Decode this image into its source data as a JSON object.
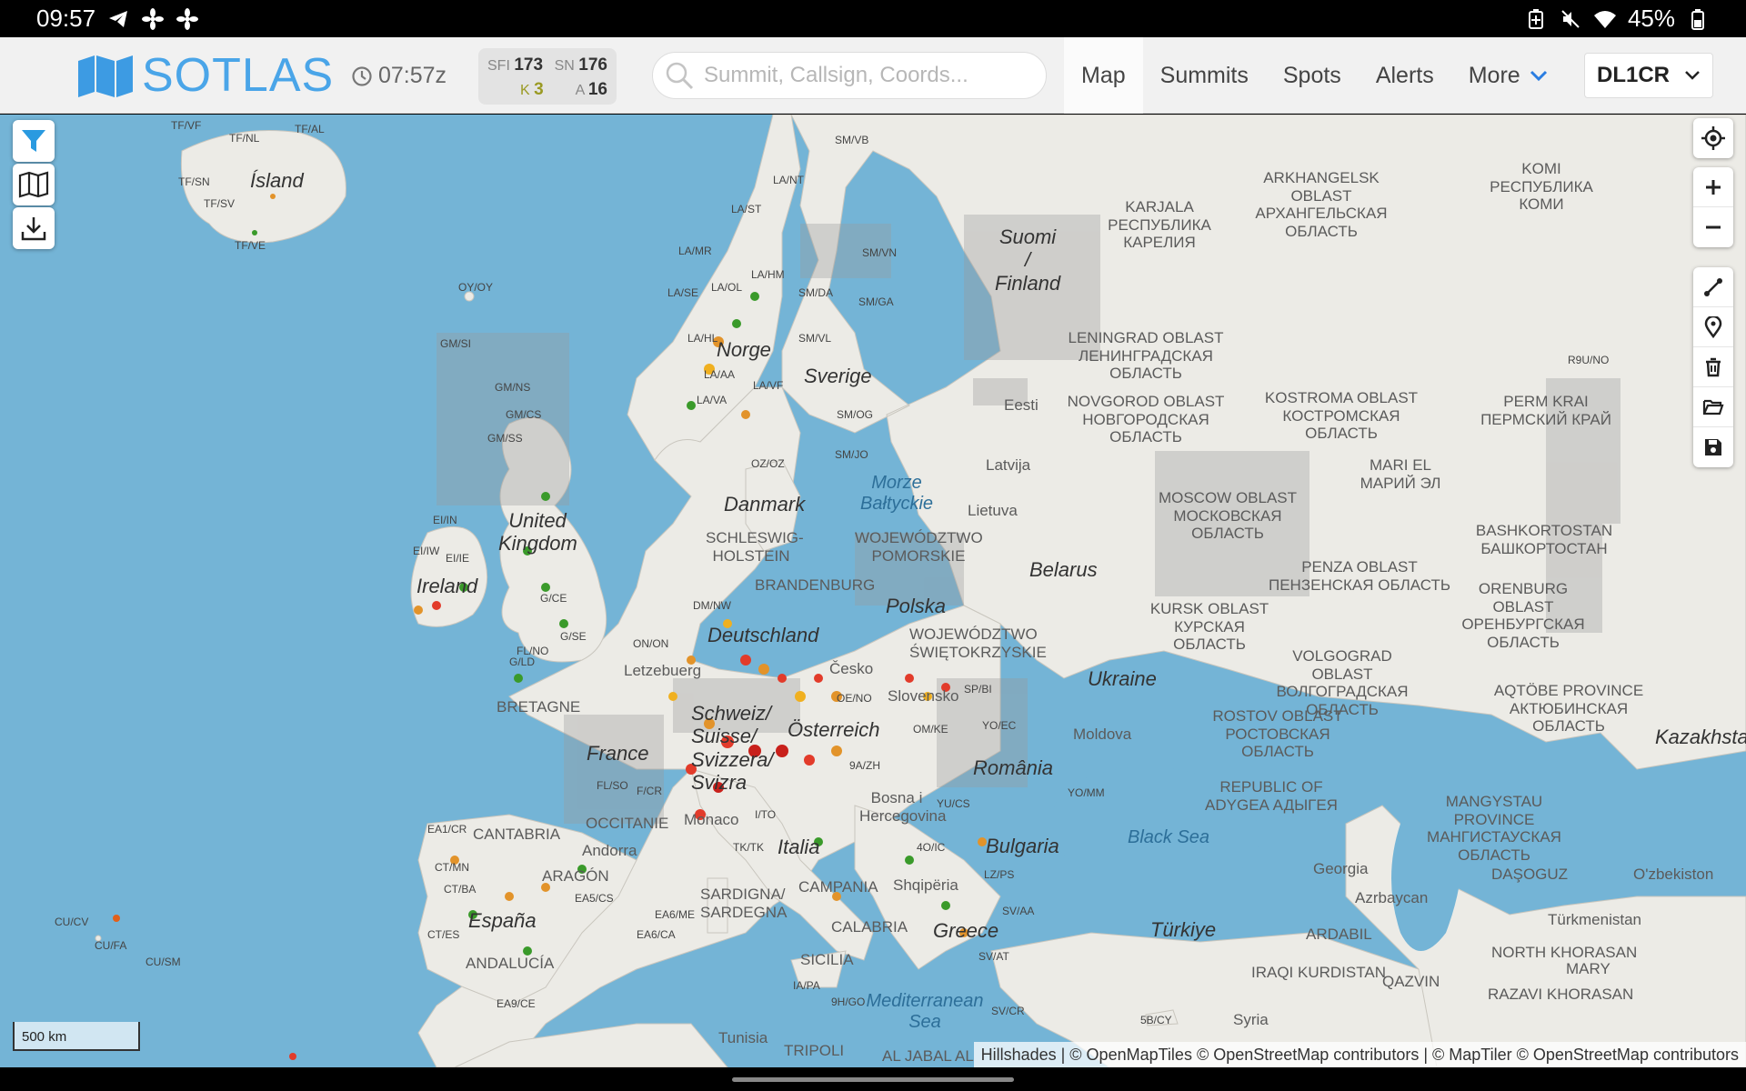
{
  "status_bar": {
    "time": "09:57",
    "battery": "45%"
  },
  "header": {
    "logo": "SOTLAS",
    "utc_time": "07:57z",
    "solar": {
      "sfi_label": "SFI",
      "sfi": "173",
      "sn_label": "SN",
      "sn": "176",
      "k_label": "K",
      "k": "3",
      "a_label": "A",
      "a": "16"
    },
    "search_placeholder": "Summit, Callsign, Coords...",
    "nav": [
      {
        "label": "Map",
        "active": true
      },
      {
        "label": "Summits"
      },
      {
        "label": "Spots"
      },
      {
        "label": "Alerts"
      },
      {
        "label": "More"
      }
    ],
    "callsign": "DL1CR"
  },
  "map": {
    "scale": "500 km",
    "attribution": "Hillshades | © OpenMapTiles © OpenStreetMap contributors | © MapTiler © OpenStreetMap contributors",
    "countries": [
      "Ísland",
      "Norge",
      "Sverige",
      "Suomi / Finland",
      "United Kingdom",
      "Ireland",
      "Danmark",
      "Deutschland",
      "Polska",
      "France",
      "España",
      "Italia",
      "Schweiz/ Suisse/ Svizzera/ Svizra",
      "Österreich",
      "Česko",
      "Slovensko",
      "România",
      "Bulgaria",
      "Greece",
      "Ukraine",
      "Belarus",
      "Moldova",
      "Türkiye",
      "Kazakhstan",
      "Tunisia",
      "Syria",
      "Georgia",
      "Azrbaycan",
      "O'zbekiston",
      "Türkmenistan",
      "Eesti",
      "Latvija",
      "Lietuva",
      "Bosna i Hercegovina",
      "Shqipëria",
      "Letzebuerg",
      "Monaco",
      "Andorra"
    ],
    "regions": [
      "KOMI РЕСПУБЛИКА КОМИ",
      "ARKHANGELSK OBLAST АРХАНГЕЛЬСКАЯ ОБЛАСТЬ",
      "KARJALA РЕСПУБЛИКА КАРЕЛИЯ",
      "LENINGRAD OBLAST ЛЕНИНГРАДСКАЯ ОБЛАСТЬ",
      "NOVGOROD OBLAST НОВГОРОДСКАЯ ОБЛАСТЬ",
      "KOSTROMA OBLAST КОСТРОМСКАЯ ОБЛАСТЬ",
      "PERM KRAI ПЕРМСКИЙ КРАЙ",
      "MARI EL МАРИЙ ЭЛ",
      "MOSCOW OBLAST МОСКОВСКАЯ ОБЛАСТЬ",
      "BASHKORTOSTAN БАШКОРТОСТАН",
      "PENZA OBLAST ПЕНЗЕНСКАЯ ОБЛАСТЬ",
      "ORENBURG OBLAST ОРЕНБУРГСКАЯ ОБЛАСТЬ",
      "KURSK OBLAST КУРСКАЯ ОБЛАСТЬ",
      "VOLGOGRAD OBLAST ВОЛГОГРАДСКАЯ ОБЛАСТЬ",
      "ROSTOV OBLAST РОСТОВСКАЯ ОБЛАСТЬ",
      "AQTÖBE PROVINCE АКТЮБИНСКАЯ ОБЛАСТЬ",
      "MANGYSTAU PROVINCE МАНГИСТАУСКАЯ ОБЛАСТЬ",
      "REPUBLIC OF ADYGEA АДЫГЕЯ",
      "SCHLESWIG-HOLSTEIN",
      "WOJEWÓDZTWO POMORSKIE",
      "BRANDENBURG",
      "WOJEWÓDZTWO ŚWIĘTOKRZYSKIE",
      "BRETAGNE",
      "OCCITANIE",
      "CANTABRIA",
      "ARAGÓN",
      "ANDALUCÍA",
      "SARDIGNA/ SARDEGNA",
      "CAMPANIA",
      "CALABRIA",
      "SICILIA",
      "DAŞOGUZ",
      "NORTH KHORASAN",
      "RAZAVI KHORASAN",
      "MARY",
      "QAZVIN",
      "ARDABIL",
      "IRAQI KURDISTAN",
      "TRIPOLI",
      "AL JABAL AL"
    ],
    "seas": [
      "Morze Bałtyckie",
      "Black Sea",
      "Mediterranean Sea"
    ],
    "associations": [
      "TF/VF",
      "TF/NL",
      "TF/AL",
      "TF/SN",
      "TF/SV",
      "TF/VE",
      "OY/OY",
      "GM/SI",
      "GM/NS",
      "GM/CS",
      "GM/SS",
      "EI/IN",
      "EI/IW",
      "EI/IE",
      "G/CE",
      "G/SE",
      "G/LD",
      "FL/NO",
      "SM/VB",
      "LA/NT",
      "LA/ST",
      "LA/MR",
      "LA/HM",
      "LA/OL",
      "LA/SE",
      "LA/HL",
      "LA/AA",
      "LA/VA",
      "LA/VF",
      "SM/VN",
      "SM/DA",
      "SM/GA",
      "SM/VL",
      "SM/OG",
      "SM/JO",
      "OZ/OZ",
      "DM/NW",
      "ON/ON",
      "OE/NO",
      "SP/BI",
      "OM/KE",
      "YO/EC",
      "9A/ZH",
      "FL/SO",
      "F/CR",
      "I/TO",
      "TK/TK",
      "YU/CS",
      "4O/IC",
      "LZ/PS",
      "SV/AA",
      "SV/AT",
      "EA1/CR",
      "CT/MN",
      "CT/BA",
      "CT/ES",
      "EA5/CS",
      "EA6/ME",
      "EA6/CA",
      "EA9/CE",
      "IA/PA",
      "9H/GO",
      "SV/CR",
      "5B/CY",
      "YO/MM",
      "R9U/NO",
      "CU/CV",
      "CU/FA",
      "CU/SM"
    ]
  }
}
